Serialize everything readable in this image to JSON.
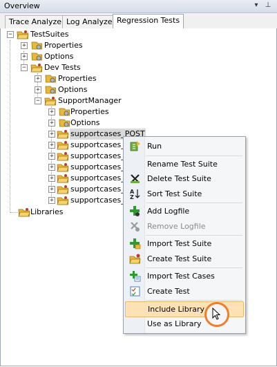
{
  "panel": {
    "title": "Overview",
    "buttons": [
      "pin-icon",
      "float-icon"
    ]
  },
  "tabs": [
    {
      "label": "Trace Analyzer",
      "active": false
    },
    {
      "label": "Log Analyzer",
      "active": false
    },
    {
      "label": "Regression Tests",
      "active": true
    }
  ],
  "tree": {
    "root": "TestSuites",
    "root_children": [
      "Properties",
      "Options",
      "Dev Tests"
    ],
    "dev_children": [
      "Properties",
      "Options",
      "SupportManager"
    ],
    "sm_children": [
      "Properties",
      "Options",
      "supportcases_POST",
      "supportcases_G",
      "supportcases_cu",
      "supportcases_su",
      "supportcases_su",
      "supportcases_G",
      "supportcases_su"
    ],
    "libraries": "Libraries",
    "selected": "supportcases_POST"
  },
  "context_menu": {
    "items": [
      {
        "label": "Run",
        "icon": "run-icon",
        "enabled": true
      },
      {
        "label": "Rename Test Suite",
        "icon": "",
        "enabled": true
      },
      {
        "label": "Delete Test Suite",
        "icon": "delete-icon",
        "enabled": true
      },
      {
        "label": "Sort Test Suite",
        "icon": "sort-az-icon",
        "enabled": true
      },
      {
        "label": "Add Logfile",
        "icon": "add-logfile-icon",
        "enabled": true
      },
      {
        "label": "Remove Logfile",
        "icon": "remove-logfile-icon",
        "enabled": false
      },
      {
        "label": "Import Test Suite",
        "icon": "import-suite-icon",
        "enabled": true
      },
      {
        "label": "Create Test Suite",
        "icon": "create-suite-icon",
        "enabled": true
      },
      {
        "label": "Import Test Cases",
        "icon": "import-cases-icon",
        "enabled": true
      },
      {
        "label": "Create Test",
        "icon": "create-test-icon",
        "enabled": true
      },
      {
        "label": "Include Library",
        "icon": "",
        "enabled": true,
        "highlighted": true
      },
      {
        "label": "Use as Library",
        "icon": "",
        "enabled": true
      }
    ]
  },
  "colors": {
    "accent": "#f07d2b",
    "hover": "#fce2b5",
    "folder": "#e8b83a"
  }
}
